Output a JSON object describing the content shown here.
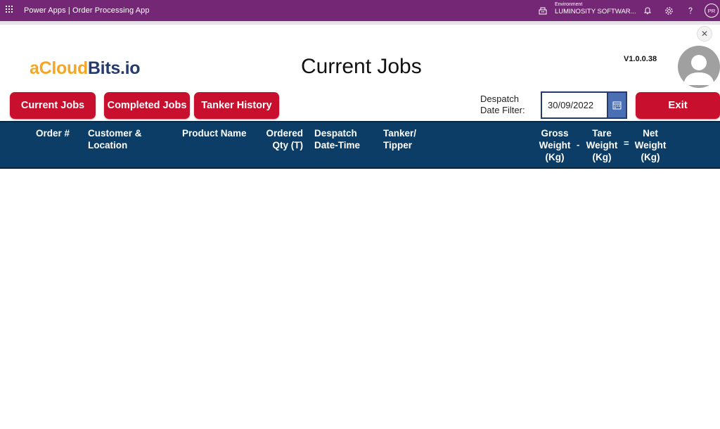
{
  "topbar": {
    "app_title": "Power Apps  |  Order Processing App",
    "environment_label": "Environment",
    "environment_name": "LUMINOSITY SOFTWAR...",
    "user_initials": "PR",
    "icons": [
      "waffle-icon",
      "environment-icon",
      "bell-icon",
      "gear-icon",
      "help-icon"
    ]
  },
  "app": {
    "close_glyph": "✕",
    "logo": {
      "part1": "aCloud",
      "part2": "Bits.io"
    },
    "title": "Current Jobs",
    "version": "V1.0.0.38",
    "buttons": {
      "current_jobs": "Current Jobs",
      "completed_jobs": "Completed Jobs",
      "tanker_history": "Tanker History",
      "exit": "Exit"
    },
    "filter": {
      "label": "Despatch Date Filter:",
      "value": "30/09/2022"
    },
    "columns": {
      "order": "Order #",
      "customer_line1": "Customer &",
      "customer_line2": "Location",
      "product": "Product Name",
      "ordered_line1": "Ordered",
      "ordered_line2": "Qty (T)",
      "despatch_line1": "Despatch",
      "despatch_line2": "Date-Time",
      "tanker_line1": "Tanker/",
      "tanker_line2": "Tipper",
      "gross_line1": "Gross",
      "gross_line2": "Weight",
      "gross_line3": "(Kg)",
      "minus": "-",
      "tare_line1": "Tare",
      "tare_line2": "Weight",
      "tare_line3": "(Kg)",
      "equals": "=",
      "net_line1": "Net",
      "net_line2": "Weight",
      "net_line3": "(Kg)"
    },
    "colors": {
      "brand_purple": "#742774",
      "button_red": "#c8102e",
      "header_navy": "#0b3d66",
      "logo_orange": "#f5a623",
      "logo_navy": "#253b6e"
    }
  }
}
